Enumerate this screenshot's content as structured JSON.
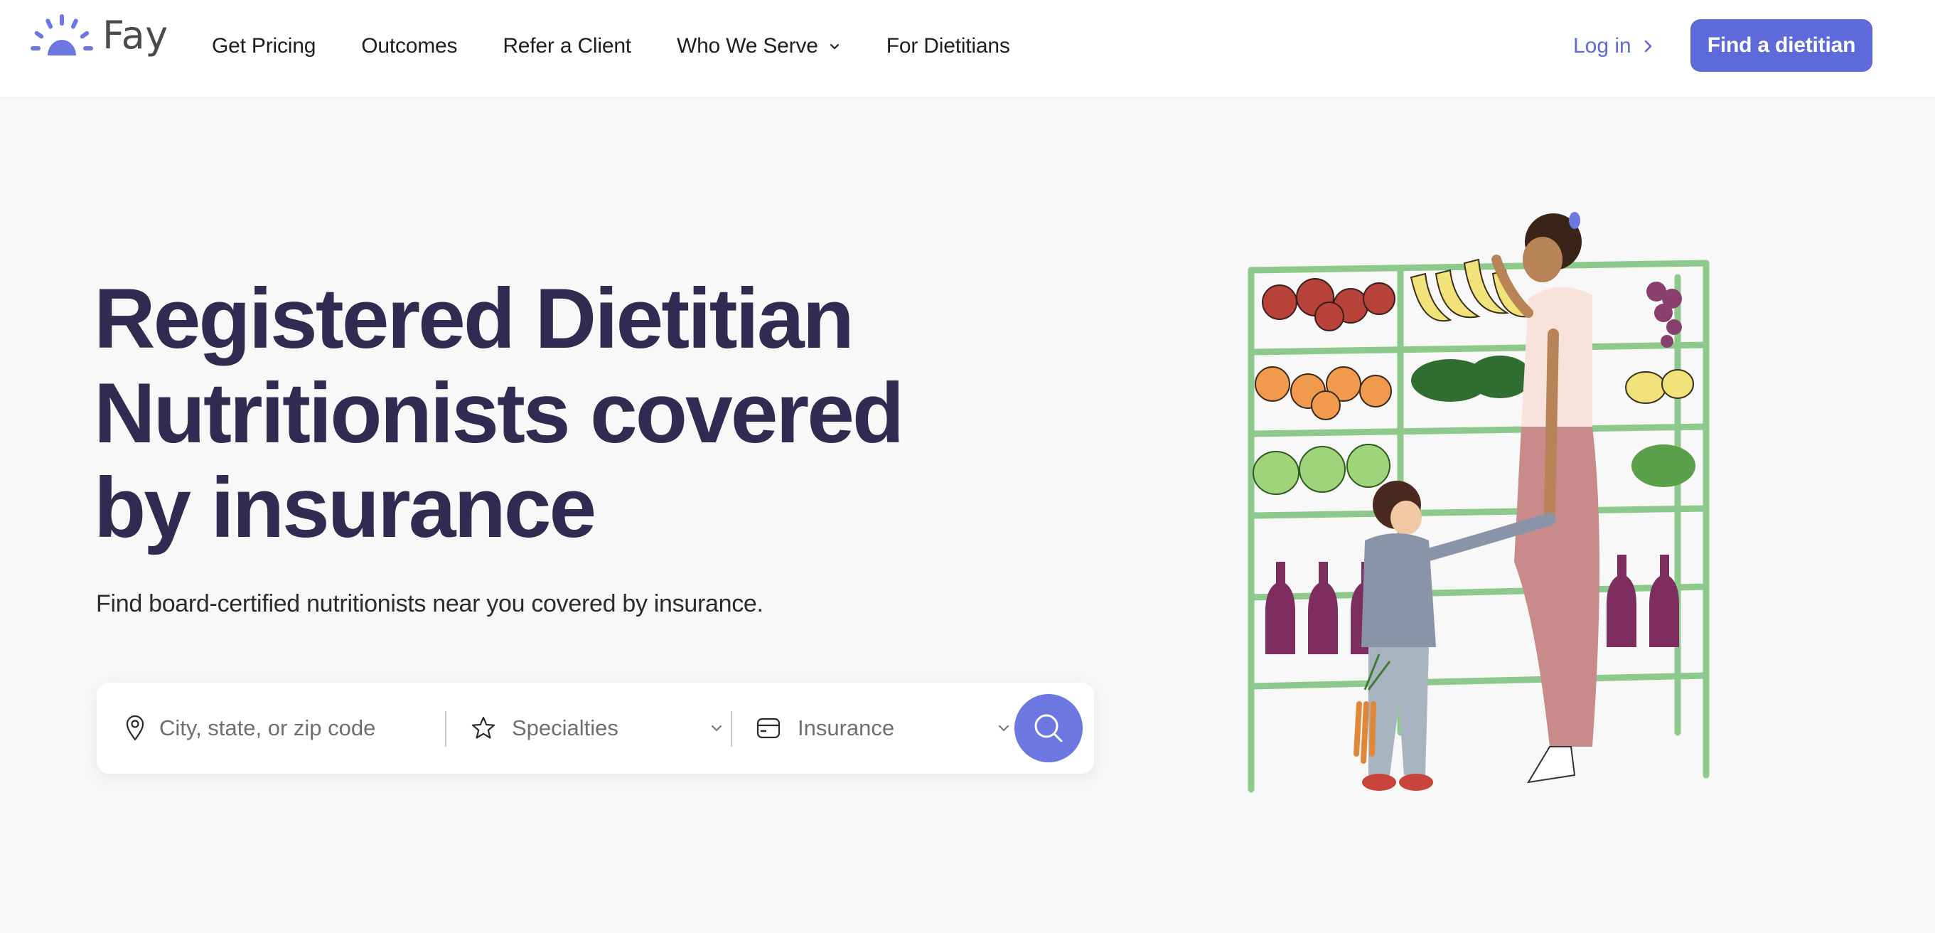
{
  "header": {
    "brand": "Fay",
    "nav": [
      {
        "label": "Get Pricing",
        "has_dropdown": false
      },
      {
        "label": "Outcomes",
        "has_dropdown": false
      },
      {
        "label": "Refer a Client",
        "has_dropdown": false
      },
      {
        "label": "Who We Serve",
        "has_dropdown": true
      },
      {
        "label": "For Dietitians",
        "has_dropdown": false
      }
    ],
    "login_label": "Log in",
    "cta_label": "Find a dietitian"
  },
  "hero": {
    "headline_lines": [
      "Registered Dietitian",
      "Nutritionists covered",
      "by insurance"
    ],
    "subtitle": "Find board-certified nutritionists near you covered by insurance."
  },
  "search": {
    "location_placeholder": "City, state, or zip code",
    "location_value": "",
    "specialties_label": "Specialties",
    "insurance_label": "Insurance",
    "icons": {
      "location": "map-pin-icon",
      "specialties": "star-icon",
      "insurance": "credit-card-icon",
      "submit": "search-icon"
    }
  },
  "illustration": {
    "alt": "Woman and child shopping for produce at a grocery shelf"
  },
  "colors": {
    "accent": "#5e6ad9",
    "search_button": "#6c77e1",
    "headline": "#332a52",
    "page_background": "#f8f8f8"
  }
}
